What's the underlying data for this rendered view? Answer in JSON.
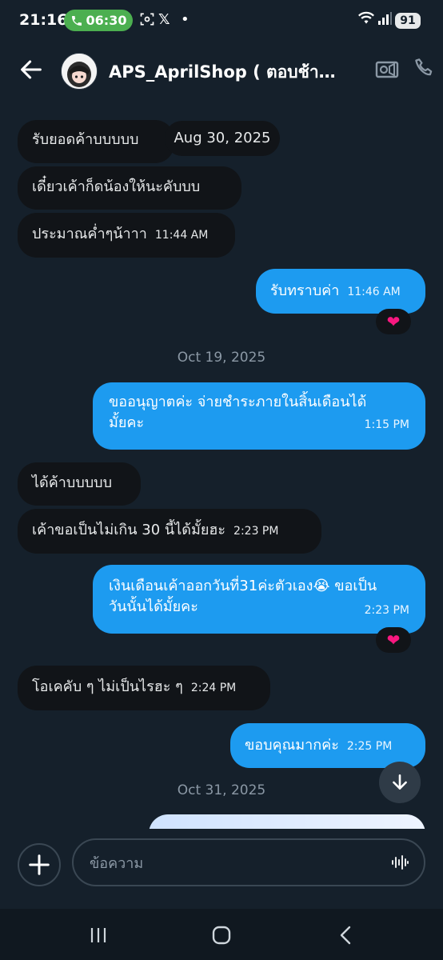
{
  "status_bar": {
    "time": "21:16",
    "call_timer": "06:30",
    "battery": "91"
  },
  "header": {
    "title": "APS_AprilShop ( ตอบช้า…"
  },
  "messages": [
    {
      "dir": "in",
      "text": "รับยอดค้าบบบบบ"
    },
    {
      "dir": "in",
      "text": "เดี๋ยวเค้าก็ดน้องให้นะคับบบ"
    },
    {
      "dir": "in",
      "text": "ประมาณค่ำๆน้าาา",
      "time": "11:44 AM"
    },
    {
      "dir": "out",
      "text": "รับทราบค่า",
      "time": "11:46 AM",
      "reaction": "❤"
    },
    {
      "dir": "out",
      "text_line1": "ขออนุญาตค่ะ จ่ายชำระภายในสิ้นเดือนได้",
      "text_line2": "มั้ยคะ",
      "time": "1:15 PM"
    },
    {
      "dir": "in",
      "text": "ได้ค้าบบบบบ"
    },
    {
      "dir": "in",
      "text": "เค้าขอเป็นไม่เกิน 30 นี้ได้มั้ยฮะ",
      "time": "2:23 PM"
    },
    {
      "dir": "out",
      "text_line1": "เงินเดือนเค้าออกวันที่31ค่ะตัวเอง😭 ขอเป็น",
      "text_line2": "วันนั้นได้มั้ยคะ",
      "time": "2:23 PM",
      "reaction": "❤"
    },
    {
      "dir": "in",
      "text": "โอเคคับ ๆ ไม่เป็นไรฮะ ๆ",
      "time": "2:24 PM"
    },
    {
      "dir": "out",
      "text": "ขอบคุณมากค่ะ",
      "time": "2:25 PM"
    }
  ],
  "date_pill": "Aug 30, 2025",
  "date_headers": [
    "Oct 19, 2025",
    "Oct 31, 2025"
  ],
  "composer": {
    "placeholder": "ข้อความ"
  },
  "colors": {
    "background": "#15202b",
    "outgoing_bubble": "#1d9bf0",
    "incoming_bubble": "#111418",
    "call_pill": "#4caf50"
  },
  "icons": [
    "back-arrow-icon",
    "video-call-icon",
    "phone-icon",
    "plus-icon",
    "audio-waveform-icon",
    "scroll-down-icon",
    "heart-icon",
    "recents-nav-icon",
    "home-nav-icon",
    "back-nav-icon"
  ]
}
